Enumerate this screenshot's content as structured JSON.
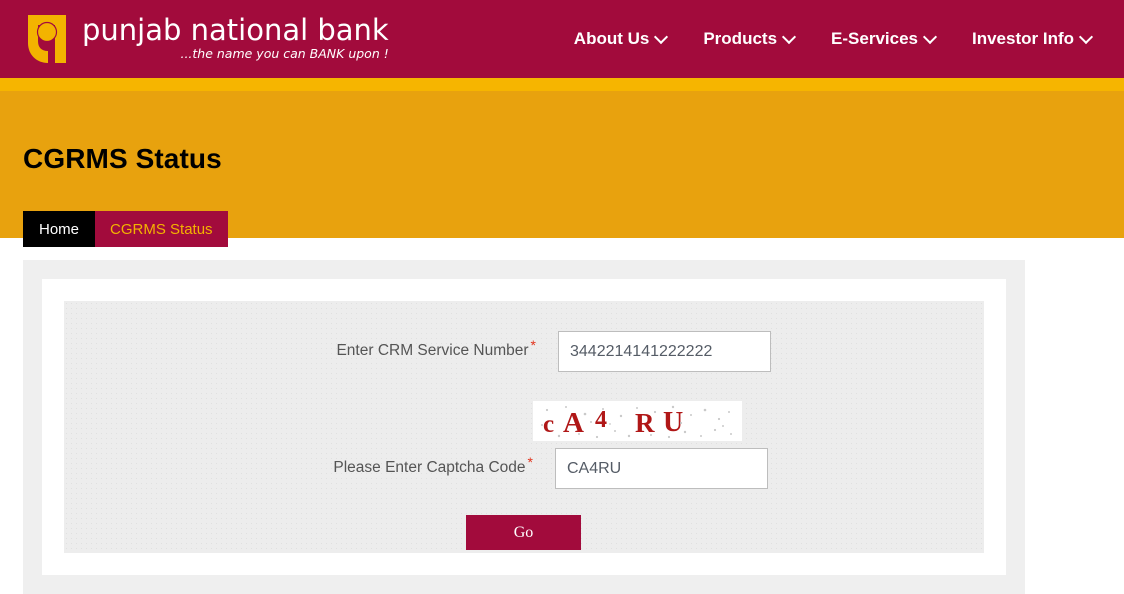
{
  "header": {
    "logo": {
      "icon": "pnb-logo-mark",
      "wordmark": "punjab national bank",
      "tagline": "...the name you can BANK upon !",
      "brand_crimson": "#a20b3c",
      "brand_gold": "#f3b300"
    },
    "nav": [
      {
        "label": "About Us",
        "icon": "chevron-down-icon"
      },
      {
        "label": "Products",
        "icon": "chevron-down-icon"
      },
      {
        "label": "E-Services",
        "icon": "chevron-down-icon"
      },
      {
        "label": "Investor Info",
        "icon": "chevron-down-icon"
      }
    ]
  },
  "banner": {
    "title": "CGRMS Status",
    "background": "#e8a20e",
    "strip": "#f6b500",
    "breadcrumb": {
      "home": "Home",
      "current": "CGRMS Status"
    }
  },
  "form": {
    "crm": {
      "label": "Enter CRM Service Number",
      "required_mark": "*",
      "value": "3442214141222222",
      "placeholder": ""
    },
    "captcha_image": {
      "icon": "captcha-image",
      "text": "cA4RU",
      "text_color": "#b01717",
      "background": "#ffffff"
    },
    "captcha": {
      "label": "Please Enter Captcha Code",
      "required_mark": "*",
      "value": "CA4RU",
      "placeholder": ""
    },
    "submit": {
      "label": "Go",
      "color": "#a20b3c"
    }
  }
}
